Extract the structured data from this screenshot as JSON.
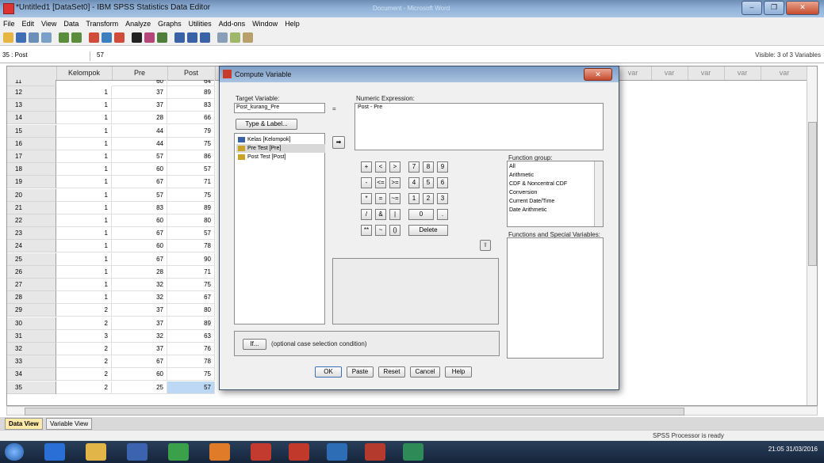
{
  "window": {
    "title": "*Untitled1 [DataSet0] - IBM SPSS Statistics Data Editor",
    "center_title": "Document - Microsoft Word",
    "controls": [
      "–",
      "❐",
      "✕"
    ]
  },
  "menu": [
    "File",
    "Edit",
    "View",
    "Data",
    "Transform",
    "Analyze",
    "Graphs",
    "Utilities",
    "Add-ons",
    "Window",
    "Help"
  ],
  "cellbar": {
    "ref": "35 : Post",
    "value": "57",
    "visible": "Visible: 3 of 3 Variables"
  },
  "grid": {
    "columns": [
      "Kelompok",
      "Pre",
      "Post",
      "var",
      "var",
      "var",
      "var",
      "var"
    ],
    "partial_row": {
      "num": "11",
      "Kelompok": "",
      "Pre": "60",
      "Post": "64"
    },
    "rows": [
      {
        "num": "12",
        "k": "1",
        "pre": "37",
        "post": "89"
      },
      {
        "num": "13",
        "k": "1",
        "pre": "37",
        "post": "83"
      },
      {
        "num": "14",
        "k": "1",
        "pre": "28",
        "post": "66"
      },
      {
        "num": "15",
        "k": "1",
        "pre": "44",
        "post": "79"
      },
      {
        "num": "16",
        "k": "1",
        "pre": "44",
        "post": "75"
      },
      {
        "num": "17",
        "k": "1",
        "pre": "57",
        "post": "86"
      },
      {
        "num": "18",
        "k": "1",
        "pre": "60",
        "post": "57"
      },
      {
        "num": "19",
        "k": "1",
        "pre": "67",
        "post": "71"
      },
      {
        "num": "20",
        "k": "1",
        "pre": "57",
        "post": "75"
      },
      {
        "num": "21",
        "k": "1",
        "pre": "83",
        "post": "89"
      },
      {
        "num": "22",
        "k": "1",
        "pre": "60",
        "post": "80"
      },
      {
        "num": "23",
        "k": "1",
        "pre": "67",
        "post": "57"
      },
      {
        "num": "24",
        "k": "1",
        "pre": "60",
        "post": "78"
      },
      {
        "num": "25",
        "k": "1",
        "pre": "67",
        "post": "90"
      },
      {
        "num": "26",
        "k": "1",
        "pre": "28",
        "post": "71"
      },
      {
        "num": "27",
        "k": "1",
        "pre": "32",
        "post": "75"
      },
      {
        "num": "28",
        "k": "1",
        "pre": "32",
        "post": "67"
      },
      {
        "num": "29",
        "k": "2",
        "pre": "37",
        "post": "80"
      },
      {
        "num": "30",
        "k": "2",
        "pre": "37",
        "post": "89"
      },
      {
        "num": "31",
        "k": "3",
        "pre": "32",
        "post": "63"
      },
      {
        "num": "32",
        "k": "2",
        "pre": "37",
        "post": "76"
      },
      {
        "num": "33",
        "k": "2",
        "pre": "67",
        "post": "78"
      },
      {
        "num": "34",
        "k": "2",
        "pre": "60",
        "post": "75"
      },
      {
        "num": "35",
        "k": "2",
        "pre": "25",
        "post": "57"
      }
    ]
  },
  "tabs": {
    "data_view": "Data View",
    "variable_view": "Variable View"
  },
  "status": "SPSS Processor is ready",
  "taskbar": {
    "time": "21:05",
    "date": "31/03/2016"
  },
  "dialog": {
    "title": "Compute Variable",
    "target_label": "Target Variable:",
    "target_value": "Post_kurang_Pre",
    "equals": "=",
    "type_label_button": "Type & Label...",
    "numeric_label": "Numeric Expression:",
    "expression": "Post - Pre",
    "variables": [
      "Kelas [Kelompok]",
      "Pre Test [Pre]",
      "Post Test [Post]"
    ],
    "transfer_arrow": "➡",
    "keypad": [
      [
        "+",
        "<",
        ">",
        "7",
        "8",
        "9"
      ],
      [
        "-",
        "<=",
        ">=",
        "4",
        "5",
        "6"
      ],
      [
        "*",
        "=",
        "~=",
        "1",
        "2",
        "3"
      ],
      [
        "/",
        "&",
        "|",
        "0",
        "."
      ],
      [
        "**",
        "~",
        "()",
        "Delete"
      ]
    ],
    "function_group_label": "Function group:",
    "function_groups": [
      "All",
      "Arithmetic",
      "CDF & Noncentral CDF",
      "Conversion",
      "Current Date/Time",
      "Date Arithmetic"
    ],
    "functions_label": "Functions and Special Variables:",
    "if_button": "If...",
    "if_text": "(optional case selection condition)",
    "buttons": [
      "OK",
      "Paste",
      "Reset",
      "Cancel",
      "Help"
    ]
  },
  "colors": {
    "selected_cell": "#bcd8f5",
    "title_gradient": "#8fb0d6",
    "taskbar": "#15243a"
  }
}
